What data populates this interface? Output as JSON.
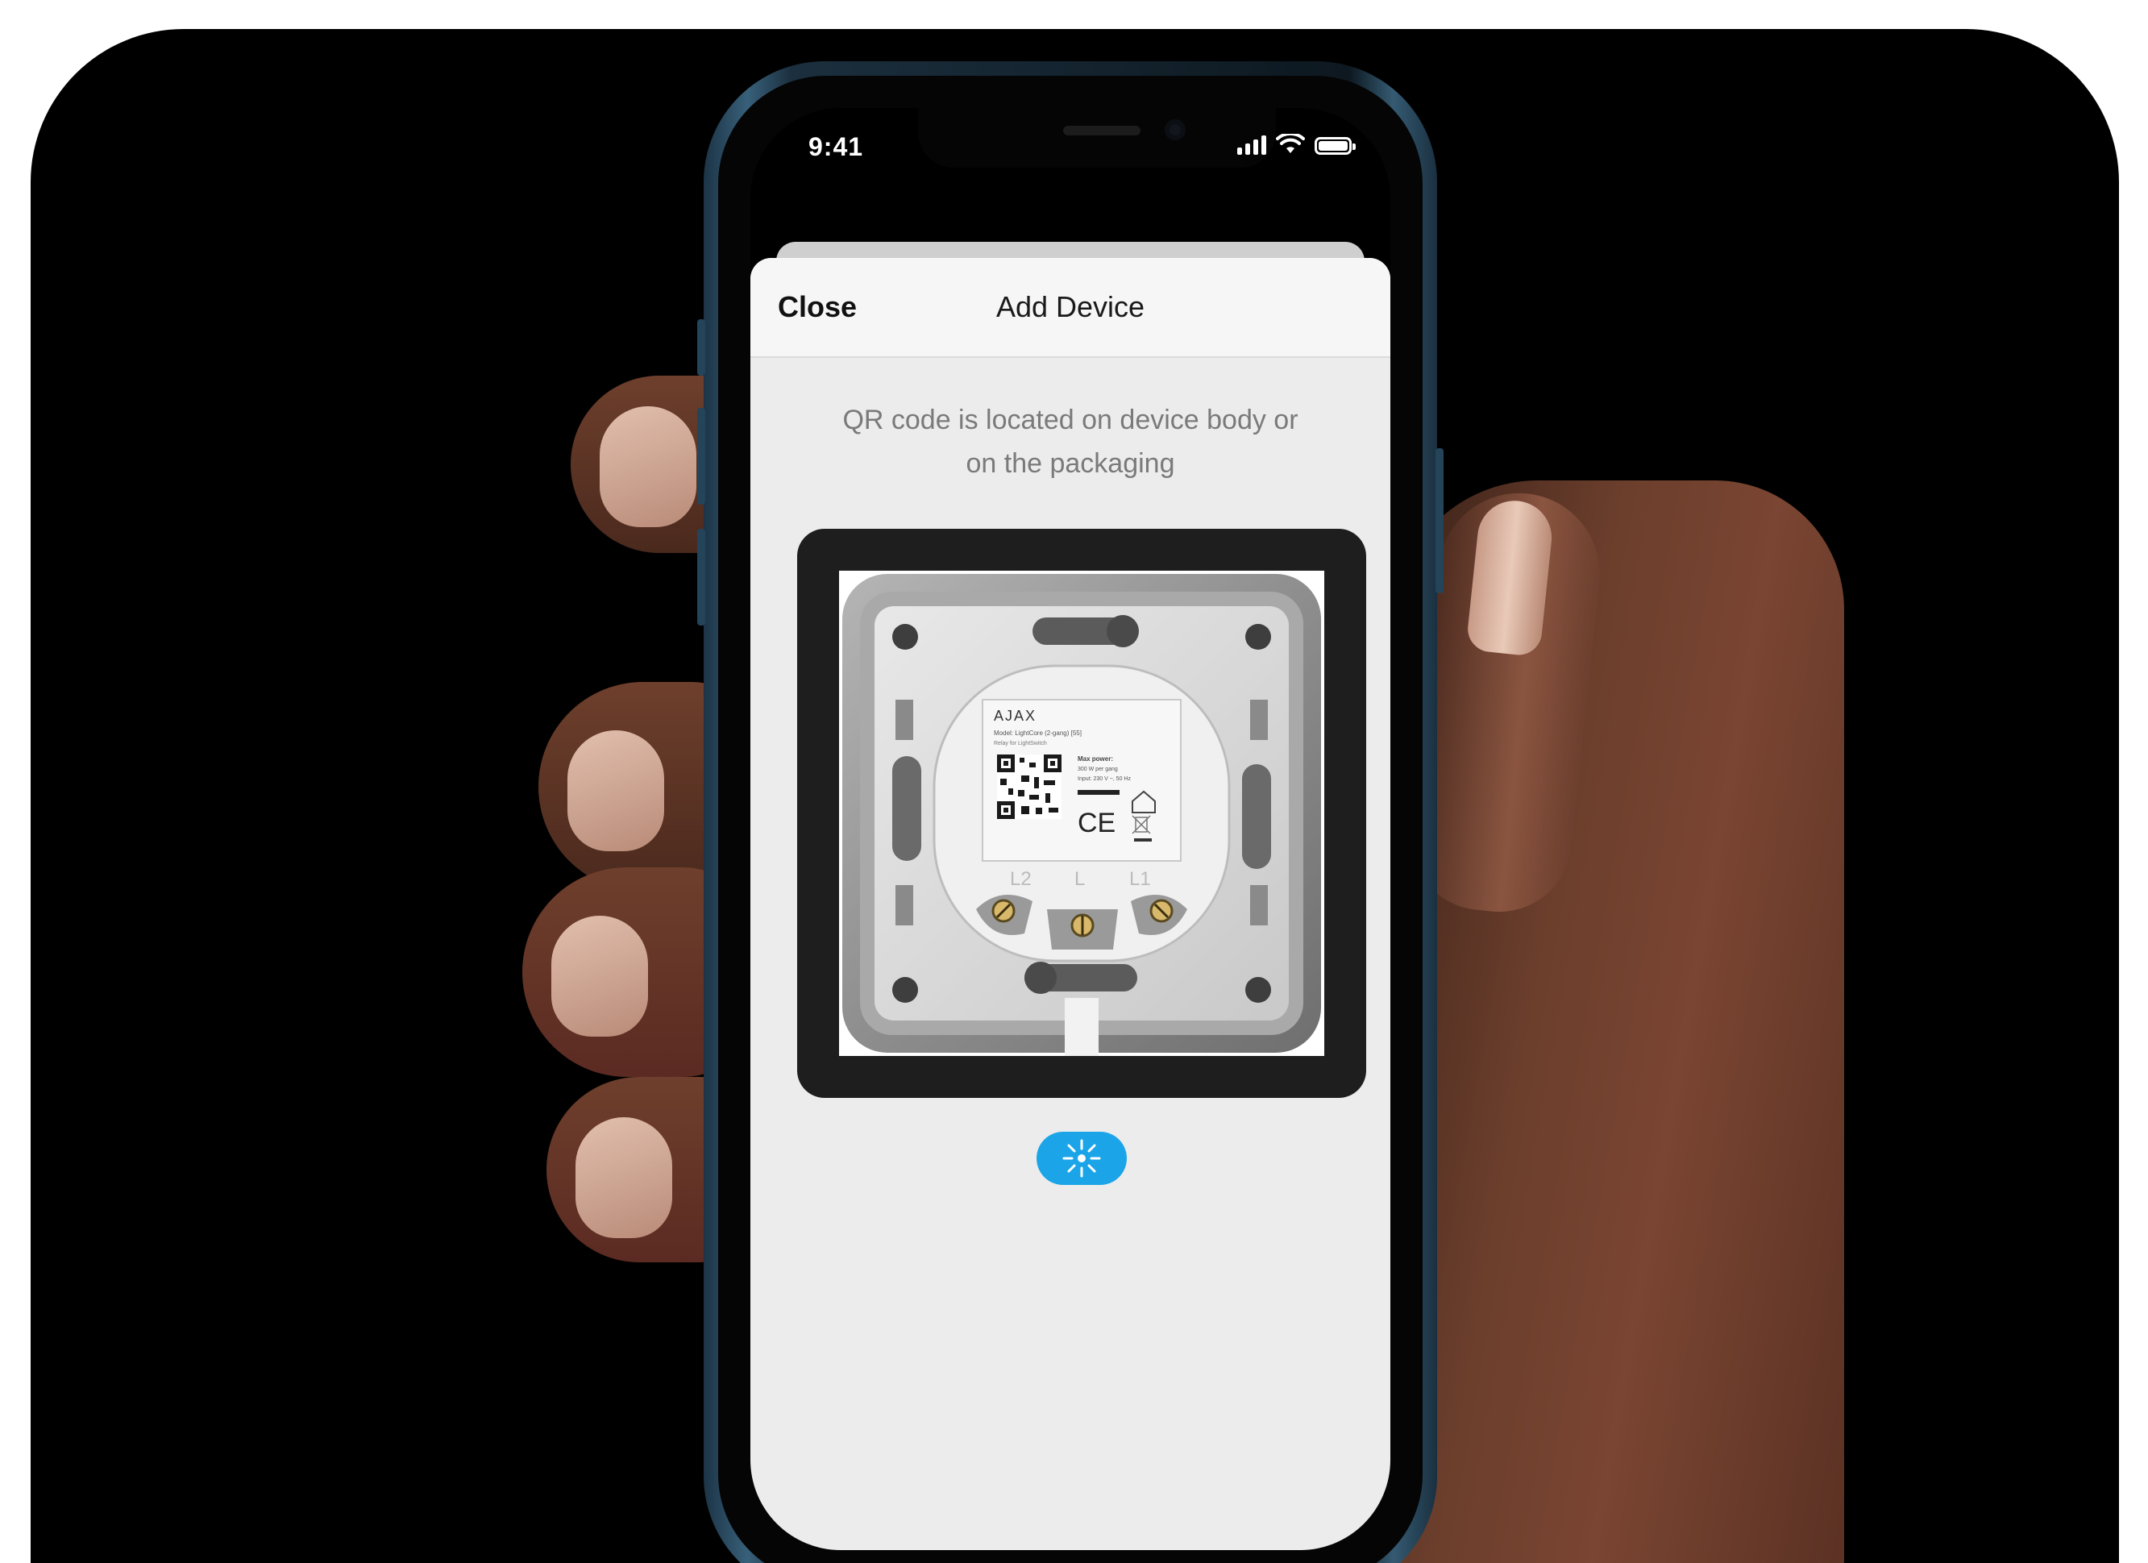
{
  "status_bar": {
    "time": "9:41"
  },
  "navbar": {
    "close_label": "Close",
    "title": "Add Device"
  },
  "scanner": {
    "hint_line1": "QR code is located on device body or",
    "hint_line2": "on the packaging",
    "device_label": {
      "brand": "AJAX",
      "model": "Model: LightCore (2-gang) [55]",
      "subtitle": "Relay for LightSwitch",
      "max_power_title": "Max power:",
      "max_power_value": "300 W per gang",
      "input": "Input: 230 V ~, 50 Hz",
      "terminal_l2": "L2",
      "terminal_l": "L",
      "terminal_l1": "L1"
    }
  },
  "flash_button": {
    "icon": "flashlight-icon"
  },
  "colors": {
    "accent": "#1ba5e8",
    "sheet_background": "#ececec",
    "navbar_background": "#f6f6f6",
    "scanner_frame": "#1e1e1e"
  }
}
